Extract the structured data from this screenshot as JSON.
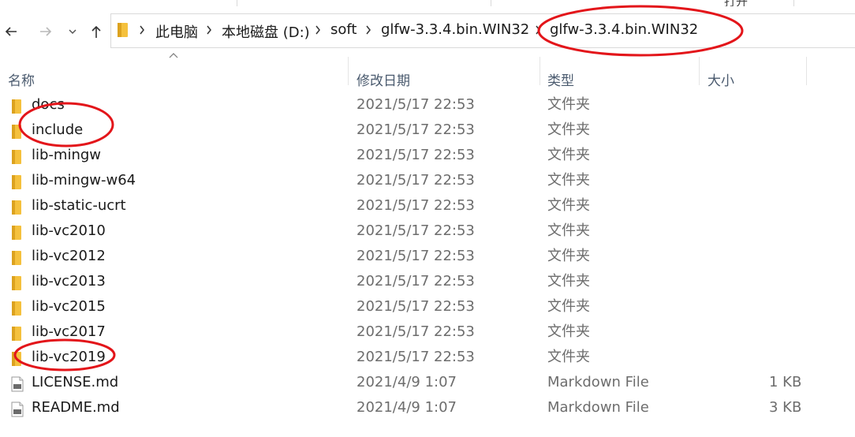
{
  "colors": {
    "accent_red": "#e3151a",
    "folder_yellow": "#f5c13d",
    "folder_dark": "#dcA21f"
  },
  "toolbar_fragments": [
    "打开"
  ],
  "nav": {
    "back_icon": "arrow-left-icon",
    "forward_icon": "arrow-right-icon",
    "recent_icon": "chevron-down-icon",
    "up_icon": "arrow-up-icon"
  },
  "breadcrumb": [
    "此电脑",
    "本地磁盘 (D:)",
    "soft",
    "glfw-3.3.4.bin.WIN32",
    "glfw-3.3.4.bin.WIN32"
  ],
  "columns": {
    "name": "名称",
    "date": "修改日期",
    "type": "类型",
    "size": "大小"
  },
  "files": [
    {
      "name": "docs",
      "date": "2021/5/17 22:53",
      "type": "文件夹",
      "size": "",
      "icon": "folder-icon"
    },
    {
      "name": "include",
      "date": "2021/5/17 22:53",
      "type": "文件夹",
      "size": "",
      "icon": "folder-icon"
    },
    {
      "name": "lib-mingw",
      "date": "2021/5/17 22:53",
      "type": "文件夹",
      "size": "",
      "icon": "folder-icon"
    },
    {
      "name": "lib-mingw-w64",
      "date": "2021/5/17 22:53",
      "type": "文件夹",
      "size": "",
      "icon": "folder-icon"
    },
    {
      "name": "lib-static-ucrt",
      "date": "2021/5/17 22:53",
      "type": "文件夹",
      "size": "",
      "icon": "folder-icon"
    },
    {
      "name": "lib-vc2010",
      "date": "2021/5/17 22:53",
      "type": "文件夹",
      "size": "",
      "icon": "folder-icon"
    },
    {
      "name": "lib-vc2012",
      "date": "2021/5/17 22:53",
      "type": "文件夹",
      "size": "",
      "icon": "folder-icon"
    },
    {
      "name": "lib-vc2013",
      "date": "2021/5/17 22:53",
      "type": "文件夹",
      "size": "",
      "icon": "folder-icon"
    },
    {
      "name": "lib-vc2015",
      "date": "2021/5/17 22:53",
      "type": "文件夹",
      "size": "",
      "icon": "folder-icon"
    },
    {
      "name": "lib-vc2017",
      "date": "2021/5/17 22:53",
      "type": "文件夹",
      "size": "",
      "icon": "folder-icon"
    },
    {
      "name": "lib-vc2019",
      "date": "2021/5/17 22:53",
      "type": "文件夹",
      "size": "",
      "icon": "folder-icon"
    },
    {
      "name": "LICENSE.md",
      "date": "2021/4/9 1:07",
      "type": "Markdown File",
      "size": "1 KB",
      "icon": "markdown-file-icon"
    },
    {
      "name": "README.md",
      "date": "2021/4/9 1:07",
      "type": "Markdown File",
      "size": "3 KB",
      "icon": "markdown-file-icon"
    }
  ]
}
